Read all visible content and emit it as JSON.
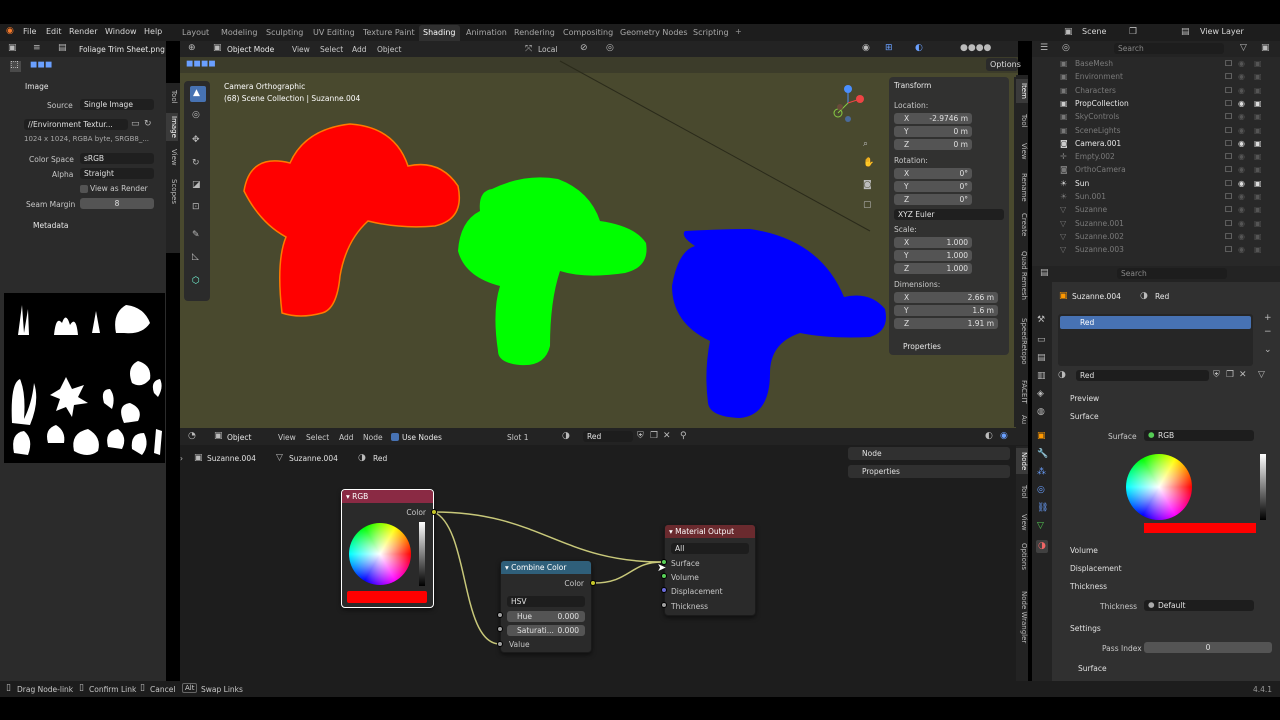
{
  "topbar": {
    "menus": [
      "File",
      "Edit",
      "Render",
      "Window",
      "Help"
    ],
    "workspaces": [
      "Layout",
      "Modeling",
      "Sculpting",
      "UV Editing",
      "Texture Paint",
      "Shading",
      "Animation",
      "Rendering",
      "Compositing",
      "Geometry Nodes",
      "Scripting"
    ],
    "active_workspace": "Shading",
    "scene": "Scene",
    "view_layer": "View Layer",
    "add": "+"
  },
  "image_editor": {
    "file": "Foliage Trim Sheet.png",
    "section": "Image",
    "source_label": "Source",
    "source": "Single Image",
    "path": "//Environment Textur...",
    "info": "1024 x 1024, RGBA byte, SRGB8_...",
    "color_space_label": "Color Space",
    "color_space": "sRGB",
    "alpha_label": "Alpha",
    "alpha": "Straight",
    "view_as_render": "View as Render",
    "seam_label": "Seam Margin",
    "seam": "8",
    "metadata": "Metadata",
    "side_tabs": [
      "Tool",
      "Image",
      "View",
      "Scopes"
    ]
  },
  "viewport": {
    "mode": "Object Mode",
    "menus": [
      "View",
      "Select",
      "Add",
      "Object"
    ],
    "pivot": "Local",
    "camera": "Camera Orthographic",
    "collection": "(68) Scene Collection | Suzanne.004",
    "options": "Options"
  },
  "transform": {
    "title": "Transform",
    "location": "Location:",
    "loc": [
      "-2.9746 m",
      "0 m",
      "0 m"
    ],
    "rotation": "Rotation:",
    "rot": [
      "0°",
      "0°",
      "0°"
    ],
    "euler": "XYZ Euler",
    "scale": "Scale:",
    "scl": [
      "1.000",
      "1.000",
      "1.000"
    ],
    "dimensions": "Dimensions:",
    "dim": [
      "2.66 m",
      "1.6 m",
      "1.91 m"
    ],
    "axes": [
      "X",
      "Y",
      "Z"
    ],
    "properties": "Properties"
  },
  "viewport_tabs": [
    "Item",
    "Tool",
    "View",
    "Rename",
    "Create",
    "Quad Remesh",
    "SpeedRetopo",
    "FACEIT",
    "Au"
  ],
  "node_editor": {
    "object": "Object",
    "menus": [
      "View",
      "Select",
      "Add",
      "Node"
    ],
    "use_nodes": "Use Nodes",
    "slot": "Slot 1",
    "material": "Red",
    "breadcrumb": [
      "Suzanne.004",
      "Suzanne.004",
      "Red"
    ],
    "sidebar": [
      "Node",
      "Properties"
    ],
    "side_tabs": [
      "Node",
      "Tool",
      "View",
      "Options",
      "Node Wrangler"
    ]
  },
  "nodes": {
    "rgb": {
      "title": "RGB",
      "out": "Color"
    },
    "combine": {
      "title": "Combine Color",
      "out": "Color",
      "mode": "HSV",
      "hue_label": "Hue",
      "hue": "0.000",
      "sat_label": "Saturati...",
      "sat": "0.000",
      "value": "Value"
    },
    "output": {
      "title": "Material Output",
      "target": "All",
      "inputs": [
        "Surface",
        "Volume",
        "Displacement",
        "Thickness"
      ]
    }
  },
  "outliner": {
    "search": "Search",
    "items": [
      {
        "name": "BaseMesh",
        "dim": true
      },
      {
        "name": "Environment",
        "dim": true
      },
      {
        "name": "Characters",
        "dim": true
      },
      {
        "name": "PropCollection",
        "dim": false
      },
      {
        "name": "SkyControls",
        "dim": true
      },
      {
        "name": "SceneLights",
        "dim": true
      },
      {
        "name": "Camera.001",
        "dim": false
      },
      {
        "name": "Empty.002",
        "dim": true
      },
      {
        "name": "OrthoCamera",
        "dim": true
      },
      {
        "name": "Sun",
        "dim": false
      },
      {
        "name": "Sun.001",
        "dim": true
      },
      {
        "name": "Suzanne",
        "dim": true
      },
      {
        "name": "Suzanne.001",
        "dim": true
      },
      {
        "name": "Suzanne.002",
        "dim": true
      },
      {
        "name": "Suzanne.003",
        "dim": true
      }
    ]
  },
  "properties": {
    "search": "Search",
    "object": "Suzanne.004",
    "material": "Red",
    "slot_item": "Red",
    "mat_name": "Red",
    "preview": "Preview",
    "surface_section": "Surface",
    "surface_label": "Surface",
    "surface_value": "RGB",
    "volume": "Volume",
    "displacement": "Displacement",
    "thickness_section": "Thickness",
    "thickness_label": "Thickness",
    "thickness_value": "Default",
    "settings": "Settings",
    "pass_index_label": "Pass Index",
    "pass_index": "0",
    "surface_sub": "Surface"
  },
  "statusbar": {
    "items": [
      "Drag Node-link",
      "Confirm Link",
      "Cancel",
      "Alt",
      "Swap Links"
    ],
    "version": "4.4.1"
  },
  "colors": {
    "red": "#ff0000",
    "green": "#00ff00",
    "blue": "#0000ff",
    "accent": "#4772b3"
  }
}
